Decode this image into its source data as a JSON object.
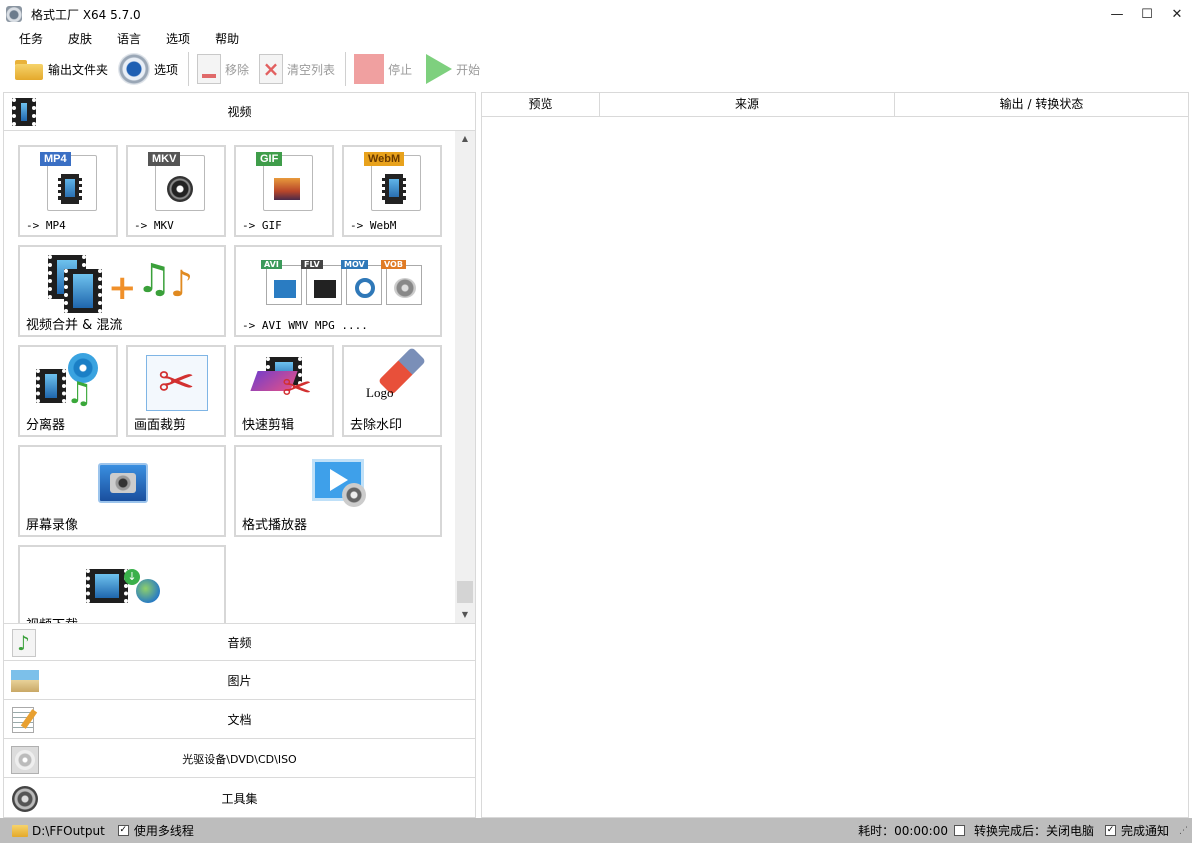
{
  "window": {
    "title": "格式工厂 X64 5.7.0",
    "minimize": "—",
    "maximize": "☐",
    "close": "✕"
  },
  "menu": [
    "任务",
    "皮肤",
    "语言",
    "选项",
    "帮助"
  ],
  "toolbar": {
    "output_folder": "输出文件夹",
    "options": "选项",
    "remove": "移除",
    "clear_list": "清空列表",
    "stop": "停止",
    "start": "开始"
  },
  "categories": {
    "video": "视频",
    "audio": "音频",
    "image": "图片",
    "document": "文档",
    "optical": "光驱设备\\DVD\\CD\\ISO",
    "tools": "工具集"
  },
  "video_tiles": {
    "mp4": {
      "label": "-> MP4",
      "tag": "MP4"
    },
    "mkv": {
      "label": "-> MKV",
      "tag": "MKV"
    },
    "gif": {
      "label": "-> GIF",
      "tag": "GIF"
    },
    "webm": {
      "label": "-> WebM",
      "tag": "WebM"
    },
    "merge": {
      "label": "视频合并 & 混流"
    },
    "other": {
      "label": "-> AVI WMV MPG ....",
      "tags": [
        "AVI",
        "FLV",
        "MOV",
        "VOB"
      ]
    },
    "splitter": {
      "label": "分离器"
    },
    "crop": {
      "label": "画面裁剪"
    },
    "quick_cut": {
      "label": "快速剪辑"
    },
    "watermark": {
      "label": "去除水印",
      "logo_text": "Logo"
    },
    "screen_record": {
      "label": "屏幕录像"
    },
    "player": {
      "label": "格式播放器"
    },
    "download": {
      "label": "视频下载"
    }
  },
  "table": {
    "columns": [
      "预览",
      "来源",
      "输出 / 转换状态"
    ]
  },
  "statusbar": {
    "output_path": "D:\\FFOutput",
    "multithread_label": "使用多线程",
    "multithread_checked": true,
    "elapsed": "耗时：00:00:00",
    "shutdown_label": "转换完成后：关闭电脑",
    "shutdown_checked": false,
    "notify_label": "完成通知",
    "notify_checked": true
  },
  "colors": {
    "tag_mp4": "#3a6fc4",
    "tag_mkv": "#555555",
    "tag_gif": "#3f9d4a",
    "tag_webm": "#e8a21c",
    "tag_avi": "#3a9a5a",
    "tag_flv": "#444444",
    "tag_mov": "#2f78b8",
    "tag_vob": "#e07b25",
    "statusbar_bg": "#bdbdbd"
  }
}
